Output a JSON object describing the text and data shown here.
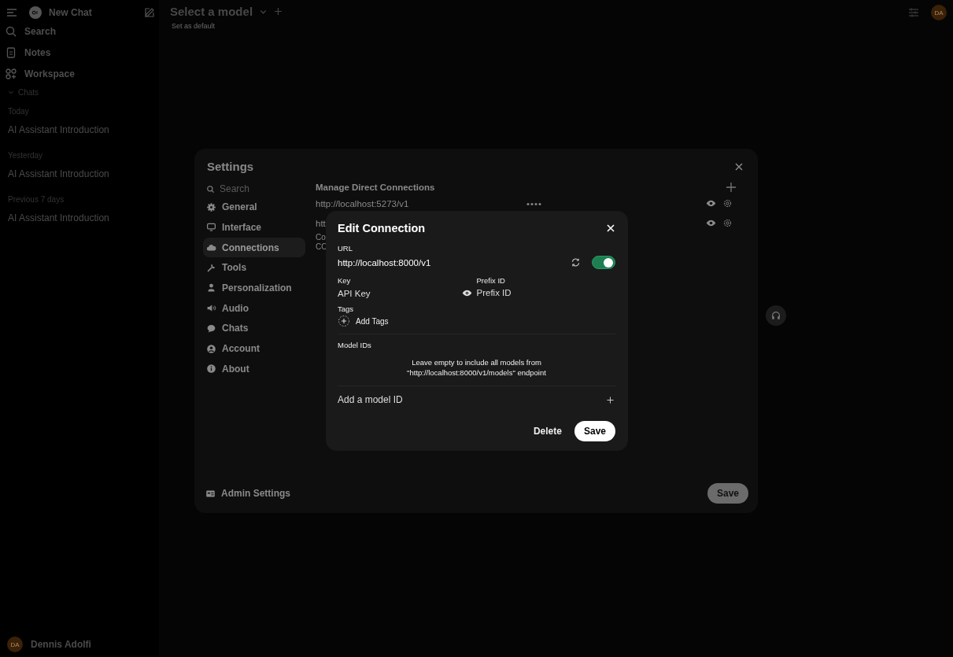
{
  "sidebar": {
    "new_chat": "New Chat",
    "nav": [
      {
        "label": "Search"
      },
      {
        "label": "Notes"
      },
      {
        "label": "Workspace"
      }
    ],
    "chats_folder": {
      "label": "Chats",
      "expanded": true
    },
    "groups": [
      {
        "label": "Today",
        "chats": [
          "AI Assistant Introduction"
        ]
      },
      {
        "label": "Yesterday",
        "chats": [
          "AI Assistant Introduction"
        ]
      },
      {
        "label": "Previous 7 days",
        "chats": [
          "AI Assistant Introduction"
        ]
      }
    ],
    "user": {
      "initials": "DA",
      "name": "Dennis Adolfi"
    }
  },
  "header": {
    "model_selector": "Select a model",
    "set_default": "Set as default",
    "avatar_initials": "DA"
  },
  "settings": {
    "title": "Settings",
    "search_placeholder": "Search",
    "tabs": [
      {
        "label": "General",
        "selected": false
      },
      {
        "label": "Interface",
        "selected": false
      },
      {
        "label": "Connections",
        "selected": true
      },
      {
        "label": "Tools",
        "selected": false
      },
      {
        "label": "Personalization",
        "selected": false
      },
      {
        "label": "Audio",
        "selected": false
      },
      {
        "label": "Chats",
        "selected": false
      },
      {
        "label": "Account",
        "selected": false
      },
      {
        "label": "About",
        "selected": false
      }
    ],
    "section_title": "Manage Direct Connections",
    "connections": [
      {
        "url": "http://localhost:5273/v1",
        "key": "••••"
      },
      {
        "url": "htt"
      }
    ],
    "notes": [
      "Co",
      "CO"
    ],
    "admin_settings": "Admin Settings",
    "save": "Save"
  },
  "edit_connection": {
    "title": "Edit Connection",
    "url_label": "URL",
    "url": "http://localhost:8000/v1",
    "enabled": true,
    "key_label": "Key",
    "key_placeholder": "API Key",
    "prefix_label": "Prefix ID",
    "prefix_placeholder": "Prefix ID",
    "tags_label": "Tags",
    "add_tags": "Add Tags",
    "model_ids_label": "Model IDs",
    "hint": "Leave empty to include all models from\n\"http://localhost:8000/v1/models\" endpoint",
    "add_model_placeholder": "Add a model ID",
    "delete": "Delete",
    "save": "Save"
  }
}
